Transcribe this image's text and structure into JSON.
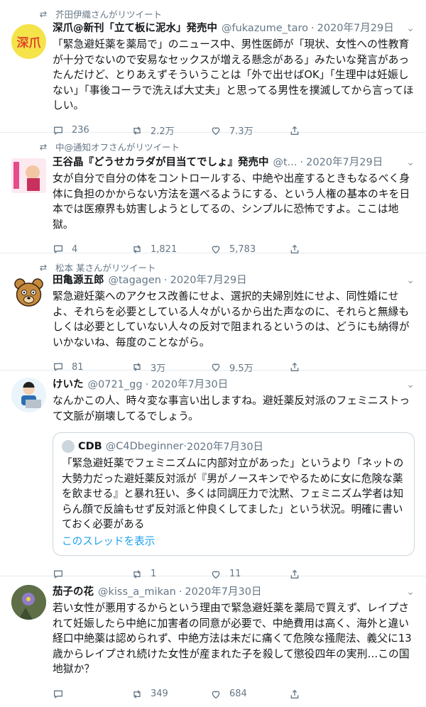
{
  "tweets": [
    {
      "retweeted_by": "芥田伊織さんがリツイート",
      "name": "深爪@新刊「立て板に泥水」発売中",
      "handle": "@fukazume_taro",
      "date": "2020年7月29日",
      "text": "「緊急避妊薬を薬局で」のニュース中、男性医師が「現状、女性への性教育が十分でないので安易なセックスが増える懸念がある」みたいな発言があったんだけど、とりあえずそういうことは「外で出せばOK」「生理中は妊娠しない」「事後コーラで洗えば大丈夫」と思ってる男性を撲滅してから言ってほしい。",
      "replies": "236",
      "retweets": "2.2万",
      "likes": "7.3万",
      "avatar_text": "深爪"
    },
    {
      "retweeted_by": "中@通知オフさんがリツイート",
      "name": "王谷晶『どうせカラダが目当てでしょ』発売中",
      "handle": "@t...",
      "date": "2020年7月29日",
      "text": "女が自分で自分の体をコントロールする、中絶や出産するときもなるべく身体に負担のかからない方法を選べるようにする、という人権の基本のキを日本では医療界も妨害しようとしてるの、シンプルに恐怖ですよ。ここは地獄。",
      "replies": "4",
      "retweets": "1,821",
      "likes": "5,783"
    },
    {
      "retweeted_by": "松本 某さんがリツイート",
      "name": "田亀源五郎",
      "handle": "@tagagen",
      "date": "2020年7月29日",
      "text": "緊急避妊薬へのアクセス改善にせよ、選択的夫婦別姓にせよ、同性婚にせよ、それらを必要としている人々がいるから出た声なのに、それらと無縁もしくは必要としていない人々の反対で阻まれるというのは、どうにも納得がいかないね、毎度のことながら。",
      "replies": "81",
      "retweets": "3万",
      "likes": "9.5万"
    },
    {
      "name": "けいた",
      "handle": "@0721_gg",
      "date": "2020年7月30日",
      "text": "なんかこの人、時々変な事言い出しますね。避妊薬反対派のフェミニストって文脈が崩壊してるでしょう。",
      "quote": {
        "name": "CDB",
        "handle": "@C4Dbeginner",
        "date": "2020年7月30日",
        "text": "「緊急避妊薬でフェミニズムに内部対立があった」というより「ネットの大勢力だった避妊薬反対派が『男がノースキンでやるために女に危険な薬を飲ませる』と暴れ狂い、多くは同調圧力で沈黙、フェミニズム学者は知らん顔で反論もせず反対派と仲良くしてました」という状況。明確に書いておく必要がある",
        "link": "このスレッドを表示"
      },
      "replies": "",
      "retweets": "1",
      "likes": "11"
    },
    {
      "name": "茄子の花",
      "handle": "@kiss_a_mikan",
      "date": "2020年7月30日",
      "text": "若い女性が悪用するからという理由で緊急避妊薬を薬局で買えず、レイプされて妊娠したら中絶に加害者の同意が必要で、中絶費用は高く、海外と違い経口中絶薬は認められず、中絶方法は未だに痛くて危険な掻爬法、義父に13歳からレイプされ続けた女性が産まれた子を殺して懲役四年の実刑…この国地獄か？",
      "replies": "",
      "retweets": "349",
      "likes": "684"
    }
  ],
  "colors": {
    "link": "#1da1f2",
    "muted": "#657786",
    "divider": "#e6ecf0"
  }
}
